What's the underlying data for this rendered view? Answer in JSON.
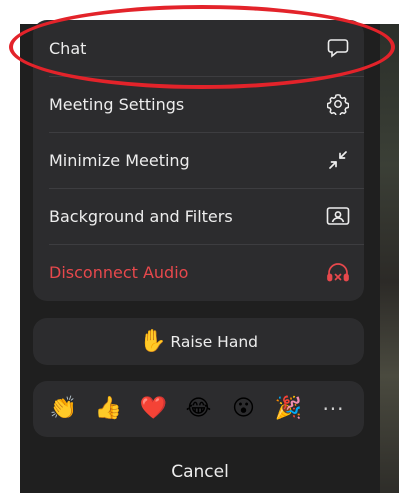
{
  "menu": {
    "items": [
      {
        "label": "Chat",
        "icon": "chat-bubble-icon"
      },
      {
        "label": "Meeting Settings",
        "icon": "gear-icon"
      },
      {
        "label": "Minimize Meeting",
        "icon": "minimize-arrows-icon"
      },
      {
        "label": "Background and Filters",
        "icon": "background-portrait-icon"
      },
      {
        "label": "Disconnect Audio",
        "icon": "headphones-x-icon"
      }
    ]
  },
  "raise_hand": {
    "emoji": "✋",
    "label": "Raise Hand"
  },
  "reactions": [
    {
      "emoji": "👏",
      "name": "clap"
    },
    {
      "emoji": "👍",
      "name": "thumbs-up"
    },
    {
      "emoji": "❤️",
      "name": "heart"
    },
    {
      "emoji": "😂",
      "name": "laugh"
    },
    {
      "emoji": "😮",
      "name": "surprised"
    },
    {
      "emoji": "🎉",
      "name": "party"
    }
  ],
  "more_label": "···",
  "cancel_label": "Cancel",
  "colors": {
    "sheet": "#1f1f1f",
    "panel": "#2c2c2e",
    "text": "#ededed",
    "danger": "#e7484c",
    "highlight": "#e3232a"
  }
}
